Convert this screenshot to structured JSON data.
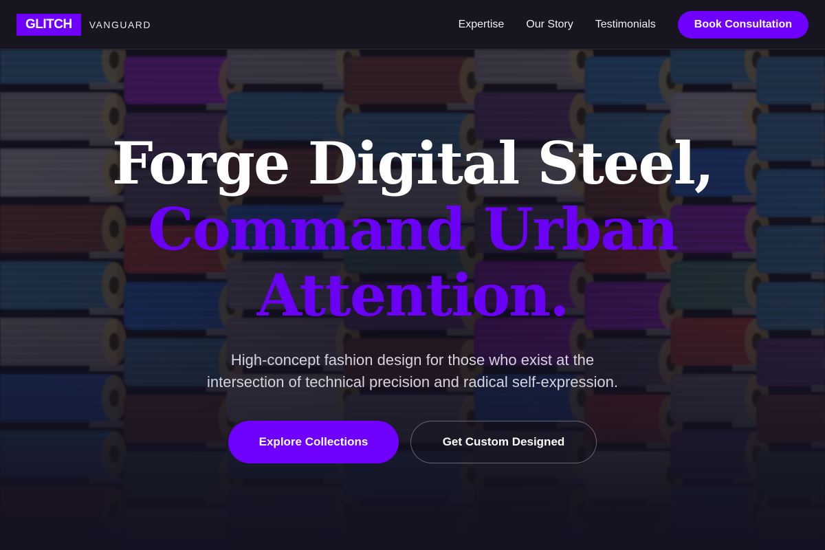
{
  "header": {
    "logo_mark": "GLITCH",
    "logo_word": "VANGUARD",
    "nav": [
      {
        "label": "Expertise"
      },
      {
        "label": "Our Story"
      },
      {
        "label": "Testimonials"
      }
    ],
    "cta_label": "Book Consultation"
  },
  "hero": {
    "headline_line1": "Forge Digital Steel,",
    "headline_line2": "Command Urban Attention.",
    "subtitle": "High-concept fashion design for those who exist at the intersection of technical precision and radical self-expression.",
    "primary_button": "Explore Collections",
    "secondary_button": "Get Custom Designed"
  },
  "colors": {
    "accent": "#6f00ff",
    "header_bg": "#17151f",
    "headline_white": "#ffffff",
    "headline_accent": "#6a00f4",
    "subtitle": "#d6d3de"
  },
  "background": {
    "subject": "thread spools image"
  }
}
